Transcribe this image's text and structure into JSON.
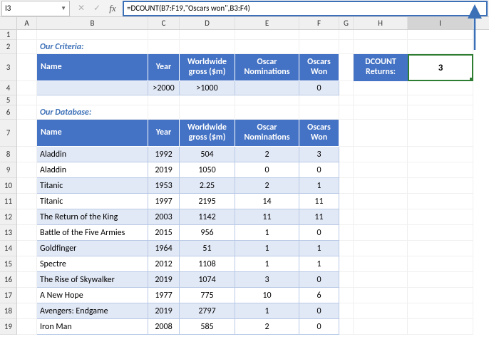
{
  "formula_bar": {
    "cell_ref": "I3",
    "formula": "=DCOUNT(B7:F19,\"Oscars won\",B3:F4)"
  },
  "columns": [
    "A",
    "B",
    "C",
    "D",
    "E",
    "F",
    "G",
    "H",
    "I"
  ],
  "section_titles": {
    "criteria": "Our Criteria:",
    "database": "Our Database:"
  },
  "headers": {
    "name": "Name",
    "year": "Year",
    "gross": "Worldwide gross ($m)",
    "noms": "Oscar Nominations",
    "won": "Oscars Won"
  },
  "criteria_row": {
    "name": "",
    "year": ">2000",
    "gross": ">1000",
    "noms": "",
    "won": "0"
  },
  "database": [
    {
      "name": "Aladdin",
      "year": "1992",
      "gross": "504",
      "noms": "2",
      "won": "3"
    },
    {
      "name": "Aladdin",
      "year": "2019",
      "gross": "1050",
      "noms": "0",
      "won": "0"
    },
    {
      "name": "Titanic",
      "year": "1953",
      "gross": "2.25",
      "noms": "2",
      "won": "1"
    },
    {
      "name": "Titanic",
      "year": "1997",
      "gross": "2195",
      "noms": "14",
      "won": "11"
    },
    {
      "name": "The Return of the King",
      "year": "2003",
      "gross": "1142",
      "noms": "11",
      "won": "11"
    },
    {
      "name": "Battle of the Five Armies",
      "year": "2015",
      "gross": "956",
      "noms": "1",
      "won": "0"
    },
    {
      "name": "Goldfinger",
      "year": "1964",
      "gross": "51",
      "noms": "1",
      "won": "1"
    },
    {
      "name": "Spectre",
      "year": "2012",
      "gross": "1108",
      "noms": "1",
      "won": "1"
    },
    {
      "name": "The Rise of Skywalker",
      "year": "2019",
      "gross": "1074",
      "noms": "3",
      "won": "0"
    },
    {
      "name": "A New Hope",
      "year": "1977",
      "gross": "775",
      "noms": "10",
      "won": "6"
    },
    {
      "name": "Avengers: Endgame",
      "year": "2019",
      "gross": "2797",
      "noms": "1",
      "won": "0"
    },
    {
      "name": "Iron Man",
      "year": "2008",
      "gross": "585",
      "noms": "2",
      "won": "0"
    }
  ],
  "result": {
    "label": "DCOUNT Returns:",
    "value": "3"
  }
}
